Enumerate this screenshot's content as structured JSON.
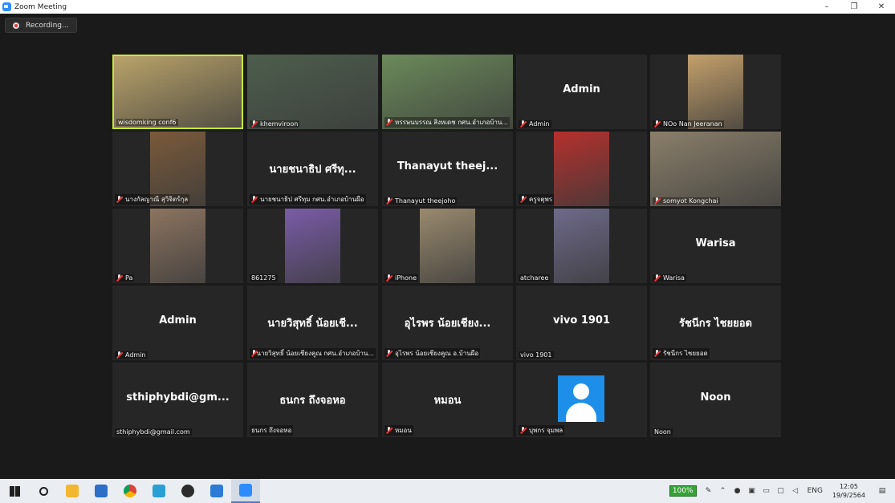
{
  "window": {
    "title": "Zoom Meeting",
    "minimize": "–",
    "maximize": "❐",
    "close": "✕"
  },
  "recording": {
    "label": "Recording..."
  },
  "tiles": [
    {
      "label": "wisdomking conf6",
      "kind": "photo",
      "muted": false,
      "active": true,
      "photo_color": "#b9a36a"
    },
    {
      "label": "khemviroon",
      "kind": "photo",
      "muted": true,
      "photo_color": "#4d5e4d"
    },
    {
      "label": "หรรษนบรรณ สิงหเดช กศน.อำเภอบ้าน...",
      "kind": "photo",
      "muted": true,
      "photo_color": "#6b8a5a"
    },
    {
      "label": "Admin",
      "kind": "name",
      "center": "Admin",
      "muted": true
    },
    {
      "label": "NOo Nan Jeeranan",
      "kind": "photo",
      "muted": true,
      "photo_color": "#c4a06b"
    },
    {
      "label": "นางกัลญาณี สุวิจิตร์กุล",
      "kind": "photo",
      "muted": true,
      "photo_color": "#7a5a3a"
    },
    {
      "label": "นายชนาธิป ศรีทุม กศน.อำเภอบ้านผือ",
      "kind": "name",
      "center": "นายชนาธิป ศรีทุ...",
      "muted": true
    },
    {
      "label": "Thanayut theejoho",
      "kind": "name",
      "center": "Thanayut theej...",
      "muted": true
    },
    {
      "label": "ครูจตุพร",
      "kind": "photo",
      "muted": true,
      "photo_color": "#b5302d"
    },
    {
      "label": "somyot Kongchai",
      "kind": "photo",
      "muted": true,
      "photo_color": "#8a7f6a"
    },
    {
      "label": "Pa",
      "kind": "photo",
      "muted": true,
      "photo_color": "#8c7460"
    },
    {
      "label": "861275",
      "kind": "photo",
      "muted": false,
      "photo_color": "#7a5ca8"
    },
    {
      "label": "iPhone",
      "kind": "photo",
      "muted": true,
      "photo_color": "#9a8a6e"
    },
    {
      "label": "atcharee",
      "kind": "photo",
      "muted": false,
      "photo_color": "#6e6a8a"
    },
    {
      "label": "Warisa",
      "kind": "name",
      "center": "Warisa",
      "muted": true
    },
    {
      "label": "Admin",
      "kind": "name",
      "center": "Admin",
      "muted": true
    },
    {
      "label": "นายวิสุทธิ์ น้อยเชียงคูณ กศน.อำเภอบ้าน...",
      "kind": "name",
      "center": "นายวิสุทธิ์ น้อยเชี...",
      "muted": true
    },
    {
      "label": "อุไรพร น้อยเชียงคูณ อ.บ้านผือ",
      "kind": "name",
      "center": "อุไรพร น้อยเชียง...",
      "muted": true
    },
    {
      "label": "vivo 1901",
      "kind": "name",
      "center": "vivo 1901",
      "muted": false
    },
    {
      "label": "รัชนีกร ไชยยอด",
      "kind": "name",
      "center": "รัชนีกร ไชยยอด",
      "muted": true
    },
    {
      "label": "sthiphybdi@gmail.com",
      "kind": "name",
      "center": "sthiphybdi@gm...",
      "muted": false
    },
    {
      "label": "ธนกร ถึงจอหอ",
      "kind": "name",
      "center": "ธนกร ถึงจอหอ",
      "muted": false
    },
    {
      "label": "หมอน",
      "kind": "name",
      "center": "หมอน",
      "muted": true
    },
    {
      "label": "บุพกร จุมพล",
      "kind": "avatar",
      "muted": true
    },
    {
      "label": "Noon",
      "kind": "name",
      "center": "Noon",
      "muted": false
    }
  ],
  "taskbar": {
    "apps": [
      {
        "name": "windows-start-icon",
        "color": "#1f1f1f"
      },
      {
        "name": "search-icon",
        "color": "#1f1f1f"
      },
      {
        "name": "file-explorer-icon",
        "color": "#f2b630"
      },
      {
        "name": "mail-icon",
        "color": "#2b6fc7"
      },
      {
        "name": "chrome-icon",
        "color": "#db4437"
      },
      {
        "name": "line-app-icon",
        "color": "#2a9fd6"
      },
      {
        "name": "obs-icon",
        "color": "#2c2c2c"
      },
      {
        "name": "photos-icon",
        "color": "#2c7bd6"
      },
      {
        "name": "zoom-icon",
        "color": "#2d8cff"
      }
    ],
    "battery": "100%",
    "language": "ENG",
    "time": "12:05",
    "date": "19/9/2564"
  }
}
